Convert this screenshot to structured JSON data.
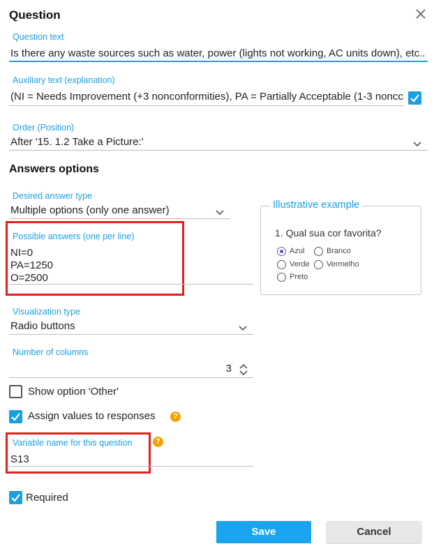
{
  "dialog": {
    "title": "Question"
  },
  "question_text": {
    "label": "Question text",
    "value": "Is there any waste sources such as water, power (lights not working, AC units down), etc.."
  },
  "auxiliary_text": {
    "label": "Auxiliary text (explanation)",
    "value": "(NI = Needs Improvement (+3 nonconformities), PA = Partially Acceptable (1-3 noncc",
    "checked": true
  },
  "order": {
    "label": "Order (Position)",
    "value": "After '15. 1.2 Take a Picture:'"
  },
  "answers_section": {
    "title": "Answers options"
  },
  "answer_type": {
    "label": "Desired answer type",
    "value": "Multiple options (only one answer)"
  },
  "possible_answers": {
    "label": "Possible answers (one per line)",
    "lines": [
      "NI=0",
      "PA=1250",
      "O=2500"
    ]
  },
  "illustrative_example": {
    "legend": "Illustrative example",
    "question": "1. Qual sua cor favorita?",
    "options": [
      {
        "label": "Azul",
        "selected": true
      },
      {
        "label": "Branco",
        "selected": false
      },
      {
        "label": "Verde",
        "selected": false
      },
      {
        "label": "Vermelho",
        "selected": false
      },
      {
        "label": "Preto",
        "selected": false
      }
    ]
  },
  "visualization_type": {
    "label": "Visualization type",
    "value": "Radio buttons"
  },
  "columns": {
    "label": "Number of columns",
    "value": "3"
  },
  "show_other": {
    "label": "Show option 'Other'",
    "checked": false
  },
  "assign_values": {
    "label": "Assign values to responses",
    "checked": true,
    "help": "?"
  },
  "variable_name": {
    "label": "Variable name for this question",
    "value": "S13",
    "help": "?"
  },
  "required": {
    "label": "Required",
    "checked": true
  },
  "buttons": {
    "save": "Save",
    "cancel": "Cancel"
  },
  "colors": {
    "accent": "#1a9fe0",
    "highlight": "#e0211b",
    "help": "#f4a300",
    "save": "#1aa3ee"
  },
  "icons": [
    "close-icon",
    "chevron-down-icon",
    "check-icon",
    "help-icon",
    "stepper-icon"
  ]
}
